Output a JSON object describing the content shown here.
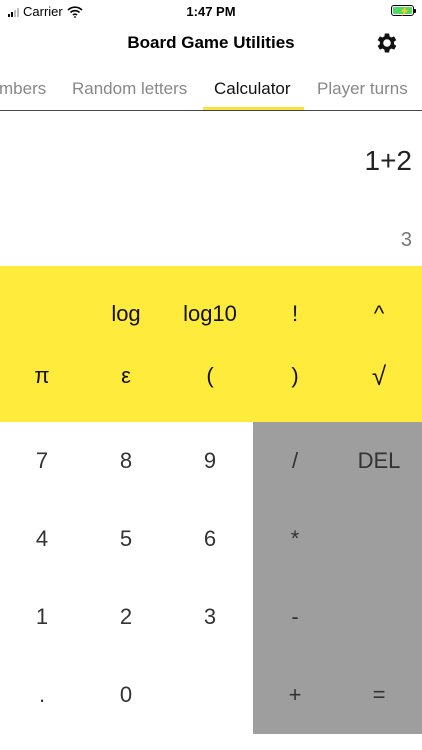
{
  "status": {
    "carrier": "Carrier",
    "time": "1:47 PM"
  },
  "nav": {
    "title": "Board Game Utilities"
  },
  "tabs": [
    {
      "label": "Random numbers",
      "visible_text": "mbers"
    },
    {
      "label": "Random letters"
    },
    {
      "label": "Calculator",
      "active": true
    },
    {
      "label": "Player turns"
    }
  ],
  "display": {
    "expression": "1+2",
    "result": "3"
  },
  "scientific": {
    "row1": [
      "log",
      "log10",
      "!",
      "^"
    ],
    "row2": [
      "π",
      "ε",
      "(",
      ")",
      "√"
    ]
  },
  "numpad": {
    "row1": [
      "7",
      "8",
      "9"
    ],
    "row2": [
      "4",
      "5",
      "6"
    ],
    "row3": [
      "1",
      "2",
      "3"
    ],
    "row4": [
      ".",
      "0"
    ]
  },
  "operators": {
    "divide": "/",
    "delete": "DEL",
    "multiply": "*",
    "minus": "-",
    "plus": "+",
    "equals": "="
  },
  "colors": {
    "accent": "#ffeb3b",
    "operator_panel": "#9e9e9e",
    "battery": "#4cd964"
  }
}
